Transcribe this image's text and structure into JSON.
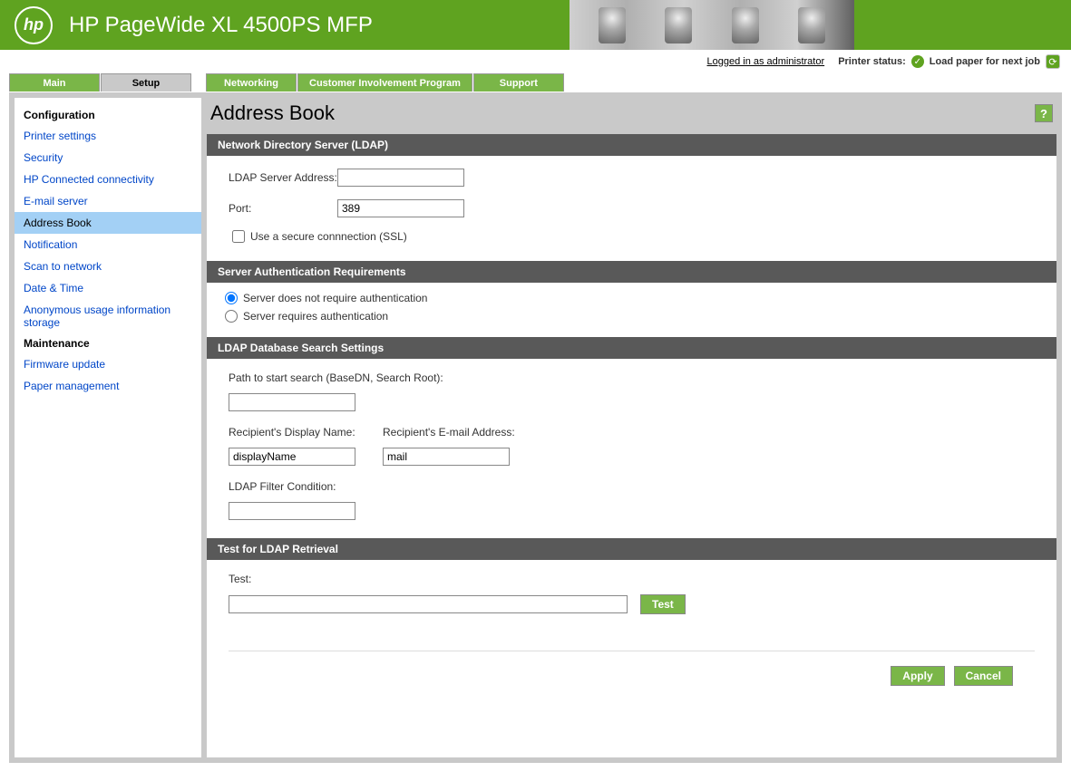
{
  "header": {
    "logo_text": "hp",
    "title": "HP PageWide XL 4500PS MFP"
  },
  "status": {
    "logged_in": "Logged in as administrator",
    "printer_status_label": "Printer status:",
    "printer_status_message": "Load paper for next job"
  },
  "tabs": {
    "main": "Main",
    "setup": "Setup",
    "networking": "Networking",
    "cip": "Customer Involvement Program",
    "support": "Support"
  },
  "sidebar": {
    "config_header": "Configuration",
    "printer_settings": "Printer settings",
    "security": "Security",
    "hp_connected": "HP Connected connectivity",
    "email_server": "E-mail server",
    "address_book": "Address Book",
    "notification": "Notification",
    "scan_network": "Scan to network",
    "date_time": "Date & Time",
    "anon_usage": "Anonymous usage information storage",
    "maint_header": "Maintenance",
    "firmware": "Firmware update",
    "paper_mgmt": "Paper management"
  },
  "page": {
    "title": "Address Book",
    "help": "?"
  },
  "sections": {
    "ldap_server": {
      "title": "Network Directory Server (LDAP)",
      "server_address_label": "LDAP Server Address:",
      "server_address_value": "",
      "port_label": "Port:",
      "port_value": "389",
      "ssl_label": "Use a secure connnection (SSL)"
    },
    "auth": {
      "title": "Server Authentication Requirements",
      "no_auth": "Server does not require authentication",
      "req_auth": "Server requires authentication"
    },
    "search": {
      "title": "LDAP Database Search Settings",
      "base_dn_label": "Path to start search (BaseDN, Search Root):",
      "base_dn_value": "",
      "display_name_label": "Recipient's Display Name:",
      "display_name_value": "displayName",
      "email_label": "Recipient's E-mail Address:",
      "email_value": "mail",
      "filter_label": "LDAP Filter Condition:",
      "filter_value": ""
    },
    "test": {
      "title": "Test for LDAP Retrieval",
      "label": "Test:",
      "value": "",
      "button": "Test"
    }
  },
  "buttons": {
    "apply": "Apply",
    "cancel": "Cancel"
  }
}
